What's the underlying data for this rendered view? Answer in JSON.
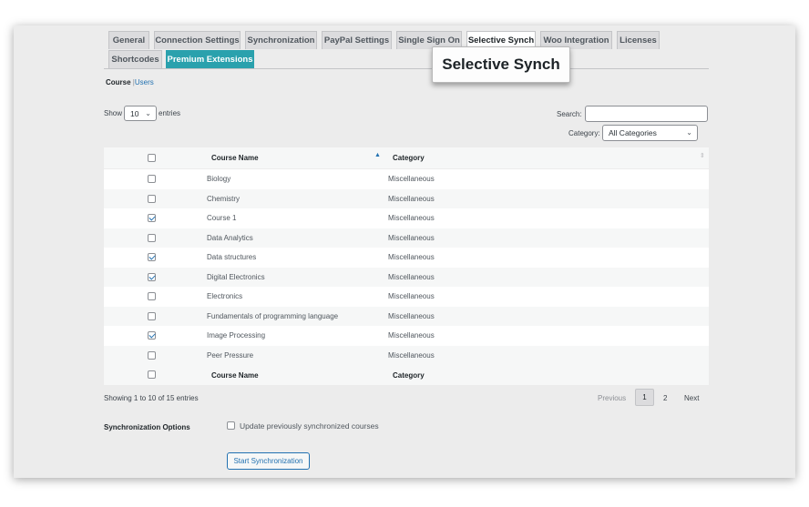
{
  "tabs": [
    {
      "label": "General"
    },
    {
      "label": "Connection Settings"
    },
    {
      "label": "Synchronization"
    },
    {
      "label": "PayPal Settings"
    },
    {
      "label": "Single Sign On"
    },
    {
      "label": "Selective Synch"
    },
    {
      "label": "Woo Integration"
    },
    {
      "label": "Licenses"
    },
    {
      "label": "Shortcodes"
    },
    {
      "label": "Premium Extensions"
    }
  ],
  "active_tab": "Selective Synch",
  "callout": "Selective Synch",
  "subnav": {
    "course": "Course",
    "separator": "|",
    "users": "Users"
  },
  "entries": {
    "show": "Show",
    "value": "10",
    "suffix": "entries"
  },
  "search": {
    "label": "Search:",
    "value": ""
  },
  "category_filter": {
    "label": "Category:",
    "value": "All Categories"
  },
  "table": {
    "columns": [
      "Course Name",
      "Category"
    ],
    "rows": [
      {
        "name": "Biology",
        "category": "Miscellaneous",
        "checked": false
      },
      {
        "name": "Chemistry",
        "category": "Miscellaneous",
        "checked": false
      },
      {
        "name": "Course 1",
        "category": "Miscellaneous",
        "checked": true
      },
      {
        "name": "Data Analytics",
        "category": "Miscellaneous",
        "checked": false
      },
      {
        "name": "Data structures",
        "category": "Miscellaneous",
        "checked": true
      },
      {
        "name": "Digital Electronics",
        "category": "Miscellaneous",
        "checked": true
      },
      {
        "name": "Electronics",
        "category": "Miscellaneous",
        "checked": false
      },
      {
        "name": "Fundamentals of programming language",
        "category": "Miscellaneous",
        "checked": false
      },
      {
        "name": "Image Processing",
        "category": "Miscellaneous",
        "checked": true
      },
      {
        "name": "Peer Pressure",
        "category": "Miscellaneous",
        "checked": false
      }
    ]
  },
  "info": "Showing 1 to 10 of 15 entries",
  "pagination": {
    "previous": "Previous",
    "pages": [
      "1",
      "2"
    ],
    "current": "1",
    "next": "Next"
  },
  "sync_options": {
    "label": "Synchronization Options",
    "checkbox_label": "Update previously synchronized courses",
    "checked": false
  },
  "start_button": "Start Synchronization",
  "colors": {
    "accent": "#2aa1ad",
    "link": "#2271b1"
  },
  "icons": {
    "sort": "sort-asc-icon",
    "dropdown": "chevron-down-icon",
    "check": "checkmark-icon"
  }
}
